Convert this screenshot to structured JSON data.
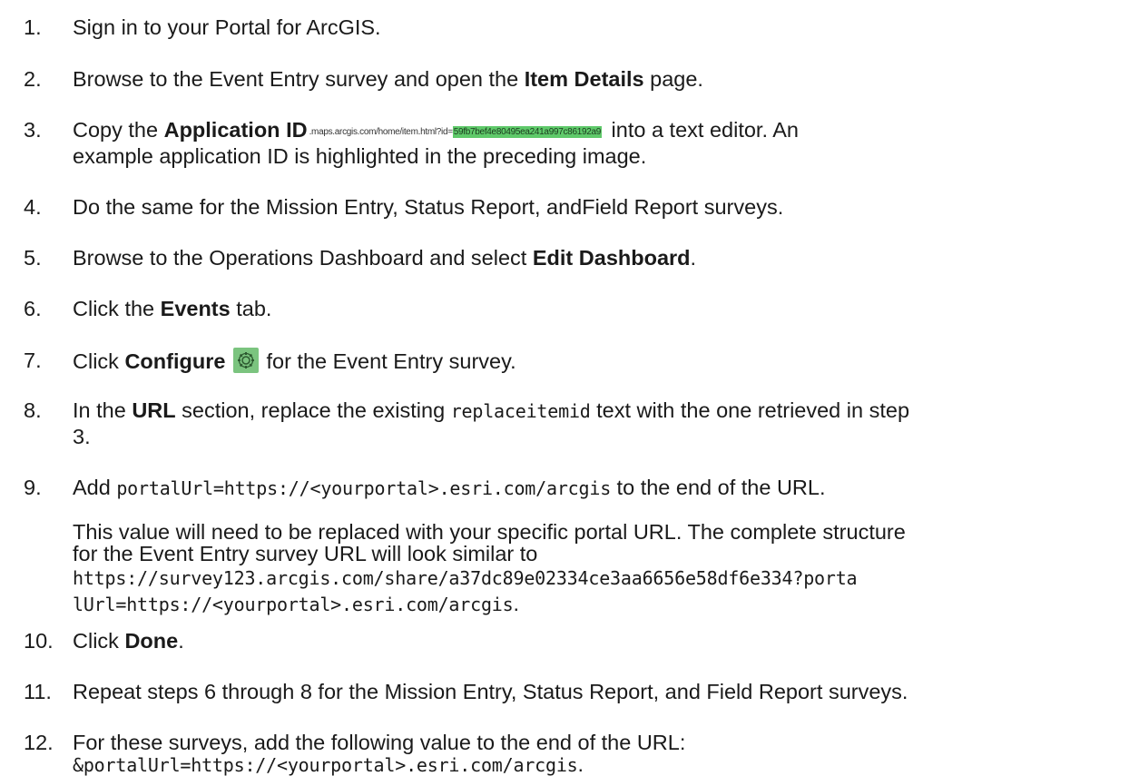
{
  "steps": [
    {
      "num": "1.",
      "text": "Sign in to your Portal for ArcGIS."
    },
    {
      "num": "2.",
      "pre": "Browse to the Event Entry survey and open the ",
      "bold": "Item Details",
      "post": " page."
    },
    {
      "num": "3.",
      "pre": "Copy the ",
      "bold": "Application ID",
      "shot_url": ".maps.arcgis.com/home/item.html?id=",
      "shot_id": "59fb7bef4e80495ea241a997c86192a9",
      "post": " into a text editor. An",
      "line2": "example application ID is highlighted in the preceding image."
    },
    {
      "num": "4.",
      "text": "Do the same for the Mission Entry, Status Report, andField Report surveys."
    },
    {
      "num": "5.",
      "pre": "Browse to the Operations Dashboard and select ",
      "bold": "Edit Dashboard",
      "post": "."
    },
    {
      "num": "6.",
      "pre": "Click the ",
      "bold": "Events",
      "post": " tab."
    },
    {
      "num": "7.",
      "pre": "Click ",
      "bold": "Configure",
      "post": " for the Event Entry survey."
    },
    {
      "num": "8.",
      "pre": "In the ",
      "bold": "URL",
      "mid": " section, replace the existing ",
      "code": "replaceitemid",
      "post": " text with the one retrieved in step",
      "line2": "3."
    },
    {
      "num": "9.",
      "pre": "Add ",
      "code": "portalUrl=https://<yourportal>.esri.com/arcgis",
      "post": " to the end of the URL."
    },
    {
      "num": "10.",
      "pre": "Click ",
      "bold": "Done",
      "post": "."
    },
    {
      "num": "11.",
      "text": "Repeat steps 6 through 8 for the Mission Entry, Status Report, and Field Report surveys."
    },
    {
      "num": "12.",
      "text": "For these surveys, add the following value to the end of the URL:",
      "code_line": "&portalUrl=https://<yourportal>.esri.com/arcgis",
      "code_line_post": "."
    }
  ],
  "note": {
    "line1": "This value will need to be replaced with your specific portal URL. The complete structure",
    "line2": "for the Event Entry survey URL will look similar to",
    "code1": "https://survey123.arcgis.com/share/a37dc89e02334ce3aa6656e58df6e334?porta",
    "code2": "lUrl=https://<yourportal>.esri.com/arcgis",
    "code2_post": "."
  },
  "icons": {
    "configure": "gear-icon"
  },
  "colors": {
    "highlight": "#5fc96a",
    "text": "#1a1a1a"
  }
}
